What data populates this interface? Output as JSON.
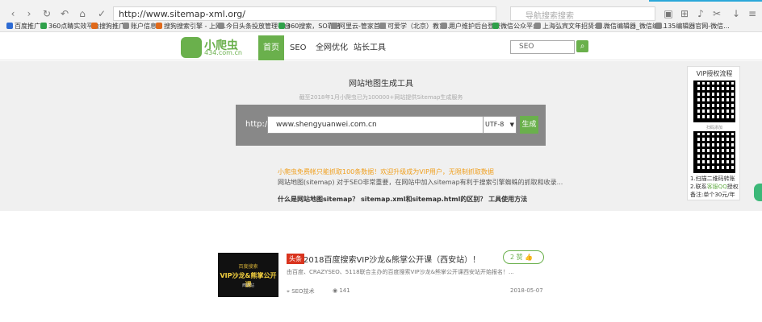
{
  "browser": {
    "url": "http://www.sitemap-xml.org/",
    "search_placeholder": "导航搜索搜索",
    "bookmarks": [
      "百度推广",
      "360点睛实效平台",
      "搜狗推广",
      "账户信息",
      "搜狗搜索引擎 - 上网...",
      "今日头条投放管理平台",
      "360搜索，SO靠谱",
      "阿里云-管家首页",
      "可爱学（北京）教育...",
      "用户维护后台登录",
      "微信公众平台",
      "上海弘宾文年招贤公...",
      "微信编辑器_微信编...",
      "135编辑器官网-微信..."
    ]
  },
  "site": {
    "logo_name": "小爬虫",
    "logo_domain": "434.com.cn",
    "nav": [
      "首页",
      "SEO",
      "全网优化",
      "站长工具"
    ],
    "search_placeholder": "SEO",
    "search_icon": "search-icon"
  },
  "tool": {
    "title": "网站地图生成工具",
    "subtitle": "截至2018年1月小爬虫已为100000+网站提供Sitemap生成服务",
    "http_label": "http://",
    "domain_value": "www.shengyuanwei.com.cn",
    "encoding": "UTF-8",
    "generate_label": "生成",
    "tip_orange": "小爬虫免费帐只能抓取100条数据！欢迎升级成为VIP用户，无限制抓取数据",
    "tip_grey": "网站地图(sitemap) 对于SEO非常重要，在网站中加入sitemap有利于搜索引擎蜘蛛的抓取和收录...",
    "tip_bold": "什么是网站地图sitemap？ sitemap.xml和sitemap.html的区别？ 工具使用方法"
  },
  "vip": {
    "title": "VIP授权流程",
    "qr_caption": "扫码添加",
    "step1": "1.扫描二维码转账",
    "step2_prefix": "2.联系",
    "step2_link": "客服QQ",
    "step2_suffix": "授权",
    "price": "备注:单个30元/年"
  },
  "article": {
    "thumb_line1": "百度搜索",
    "thumb_line2": "VIP沙龙&熊掌公开课",
    "thumb_line3": "西安站",
    "badge": "头条",
    "title": "2018百度搜索VIP沙龙&熊掌公开课（西安站）！",
    "likes": "2 赞",
    "desc": "由百度、CRAZYSEO、5118联合主办的百度搜索VIP沙龙&熊掌公开课西安站开始报名！...",
    "category": "SEO技术",
    "views": "141",
    "date": "2018-05-07"
  }
}
